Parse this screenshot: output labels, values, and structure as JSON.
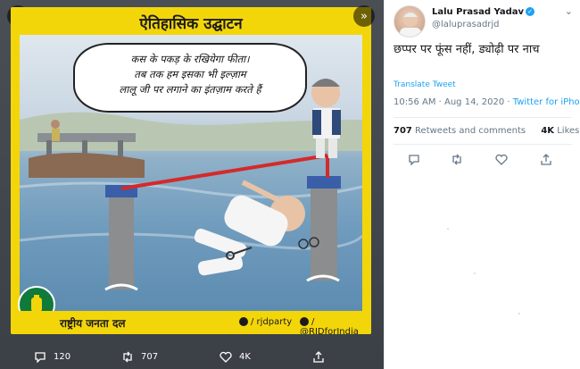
{
  "poster": {
    "title": "ऐतिहासिक उद्घाटन",
    "bubble_lines": [
      "कस के पकड़ के रखियेगा फीता।",
      "तब तक हम इसका भी इल्ज़ाम",
      "लालू जी पर लगाने का इंतज़ाम करते हैं"
    ],
    "party_name": "राष्ट्रीय जनता दल",
    "fb_handle": "/ rjdparty",
    "tw_handle": "/ @RJDforIndia"
  },
  "media_actions": {
    "replies": "120",
    "retweets": "707",
    "likes": "4K"
  },
  "tweet": {
    "author": "Lalu Prasad Yadav",
    "handle": "@laluprasadrjd",
    "text": "छप्पर पर फूंस नहीं, ड्योढ़ी पर नाच",
    "translate": "Translate Tweet",
    "timestamp": "10:56 AM · Aug 14, 2020 · ",
    "source": "Twitter for iPhone",
    "retweets_count": "707",
    "retweets_label": " Retweets and comments",
    "likes_count": "4K",
    "likes_label": " Likes"
  },
  "colors": {
    "poster_yellow": "#f3d60a",
    "twitter_blue": "#1da1f2",
    "text_dark": "#14171a",
    "text_grey": "#657786"
  },
  "icons": [
    "close-icon",
    "expand-icon",
    "reply-icon",
    "retweet-icon",
    "like-icon",
    "share-icon",
    "verified-icon",
    "caret-down-icon",
    "facebook-icon",
    "twitter-icon",
    "lantern-logo"
  ]
}
